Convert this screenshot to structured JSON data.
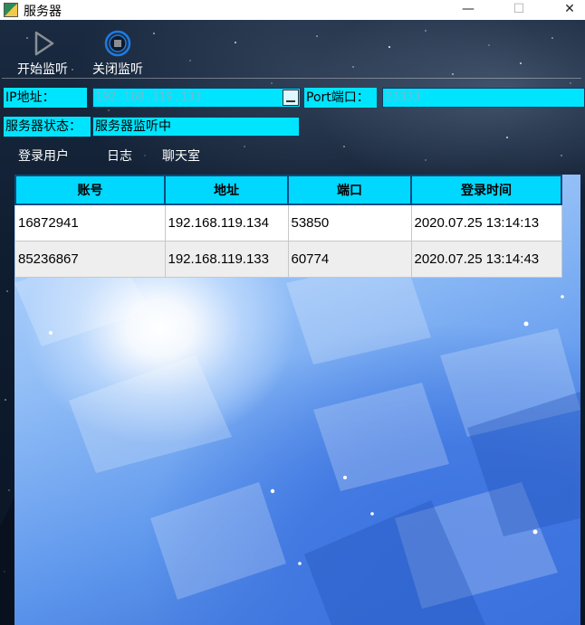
{
  "window": {
    "title": "服务器",
    "minimize_glyph": "—",
    "maximize_glyph": "☐",
    "close_glyph": "✕"
  },
  "toolbar": {
    "start_label": "开始监听",
    "start_icon": "play-icon",
    "stop_label": "关闭监听",
    "stop_icon": "stop-circle-icon",
    "stop_icon_color": "#1e7be0"
  },
  "form": {
    "ip_label": "IP地址：",
    "ip_value": "192.168.119.133",
    "port_label": "Port端口：",
    "port_value": "23333",
    "status_label": "服务器状态：",
    "status_value": "服务器监听中",
    "field_color": "#00e5ff"
  },
  "tabs": [
    {
      "label": "登录用户"
    },
    {
      "label": "日志"
    },
    {
      "label": "聊天室"
    }
  ],
  "table": {
    "headers": [
      "账号",
      "地址",
      "端口",
      "登录时间"
    ],
    "rows": [
      [
        "16872941",
        "192.168.119.134",
        "53850",
        "2020.07.25 13:14:13"
      ],
      [
        "85236867",
        "192.168.119.133",
        "60774",
        "2020.07.25 13:14:43"
      ]
    ]
  }
}
